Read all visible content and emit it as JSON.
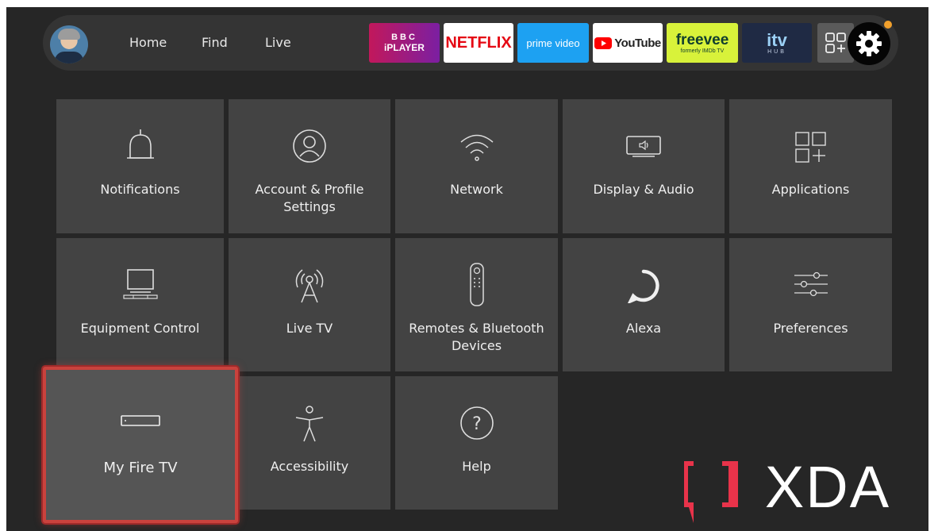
{
  "nav": {
    "home": "Home",
    "find": "Find",
    "live": "Live"
  },
  "apps": {
    "bbc_line1": "BBC",
    "bbc_line2": "iPLAYER",
    "netflix": "NETFLIX",
    "prime": "prime video",
    "youtube": "YouTube",
    "freevee": "freevee",
    "freevee_sub": "formerly IMDb TV",
    "itv": "itv",
    "itv_sub": "HUB"
  },
  "tiles": {
    "notifications": "Notifications",
    "account": "Account & Profile Settings",
    "network": "Network",
    "display": "Display & Audio",
    "applications": "Applications",
    "equipment": "Equipment Control",
    "livetv": "Live TV",
    "remotes": "Remotes & Bluetooth Devices",
    "alexa": "Alexa",
    "preferences": "Preferences",
    "myfiretv": "My Fire TV",
    "accessibility": "Accessibility",
    "help": "Help"
  },
  "watermark": "XDA",
  "colors": {
    "selection": "#c9423d",
    "settings_dot": "#f1a02c",
    "xda_red": "#e8334a"
  }
}
